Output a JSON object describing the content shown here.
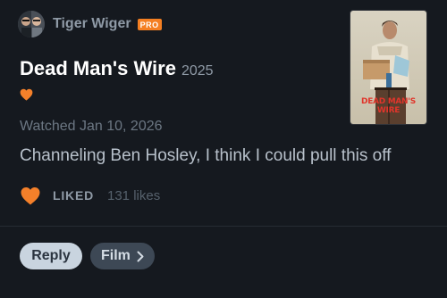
{
  "header": {
    "username": "Tiger Wiger",
    "badge": "PRO"
  },
  "film": {
    "title": "Dead Man's Wire",
    "year": "2025",
    "poster_title": "DEAD MAN'S WIRE"
  },
  "review": {
    "watched": "Watched Jan 10, 2026",
    "text": "Channeling Ben Hosley, I think I could pull this off",
    "liked_label": "LIKED",
    "likes": "131 likes"
  },
  "actions": {
    "reply_label": "Reply",
    "film_label": "Film"
  },
  "colors": {
    "background": "#15191f",
    "accent": "#f47f22",
    "heart": "#f4802a"
  },
  "icons": [
    "avatar",
    "heart-icon",
    "chevron-right-icon"
  ]
}
